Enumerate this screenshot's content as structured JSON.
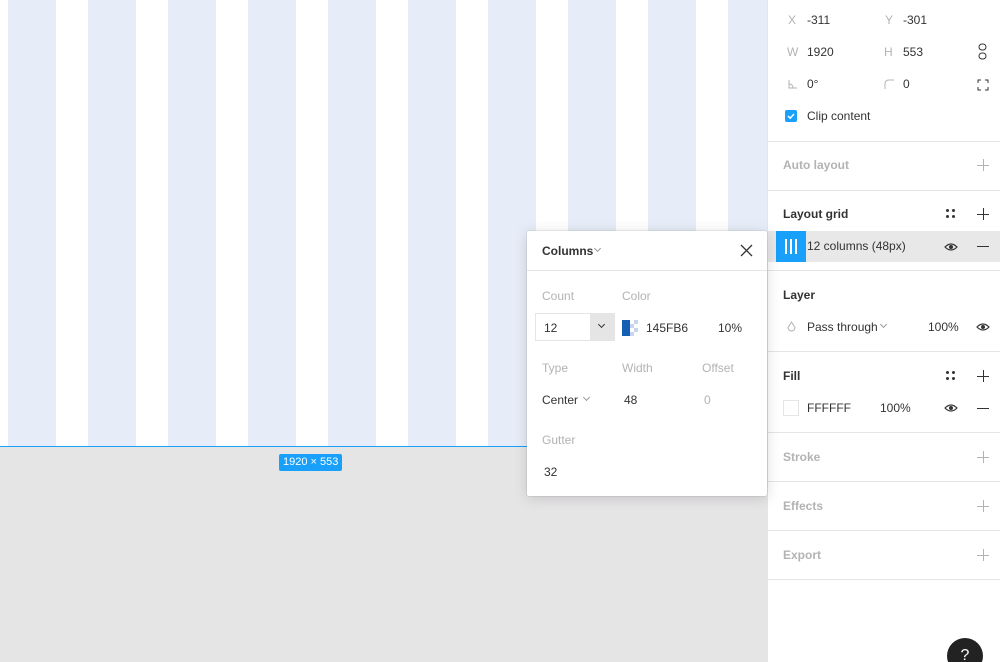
{
  "canvas": {
    "frame_size_label": "1920 × 553",
    "column_fill": "#e7edf8",
    "selection_color": "#18a0fb"
  },
  "design": {
    "x_label": "X",
    "x_value": "-311",
    "y_label": "Y",
    "y_value": "-301",
    "w_label": "W",
    "w_value": "1920",
    "h_label": "H",
    "h_value": "553",
    "rotation_value": "0°",
    "radius_value": "0",
    "clip_content_label": "Clip content",
    "clip_content_checked": true
  },
  "sections": {
    "auto_layout": "Auto layout",
    "layout_grid": "Layout grid",
    "layer": "Layer",
    "fill": "Fill",
    "stroke": "Stroke",
    "effects": "Effects",
    "export": "Export"
  },
  "layout_grid": {
    "item_label": "12 columns (48px)"
  },
  "layer": {
    "blend_mode": "Pass through",
    "opacity": "100%"
  },
  "fill": {
    "hex": "FFFFFF",
    "opacity": "100%"
  },
  "popover": {
    "title": "Columns",
    "count_label": "Count",
    "count_value": "12",
    "color_label": "Color",
    "color_hex": "145FB6",
    "color_opacity": "10%",
    "color": "#145fb6",
    "type_label": "Type",
    "type_value": "Center",
    "width_label": "Width",
    "width_value": "48",
    "offset_label": "Offset",
    "offset_value": "0",
    "gutter_label": "Gutter",
    "gutter_value": "32"
  },
  "help_button": "?"
}
